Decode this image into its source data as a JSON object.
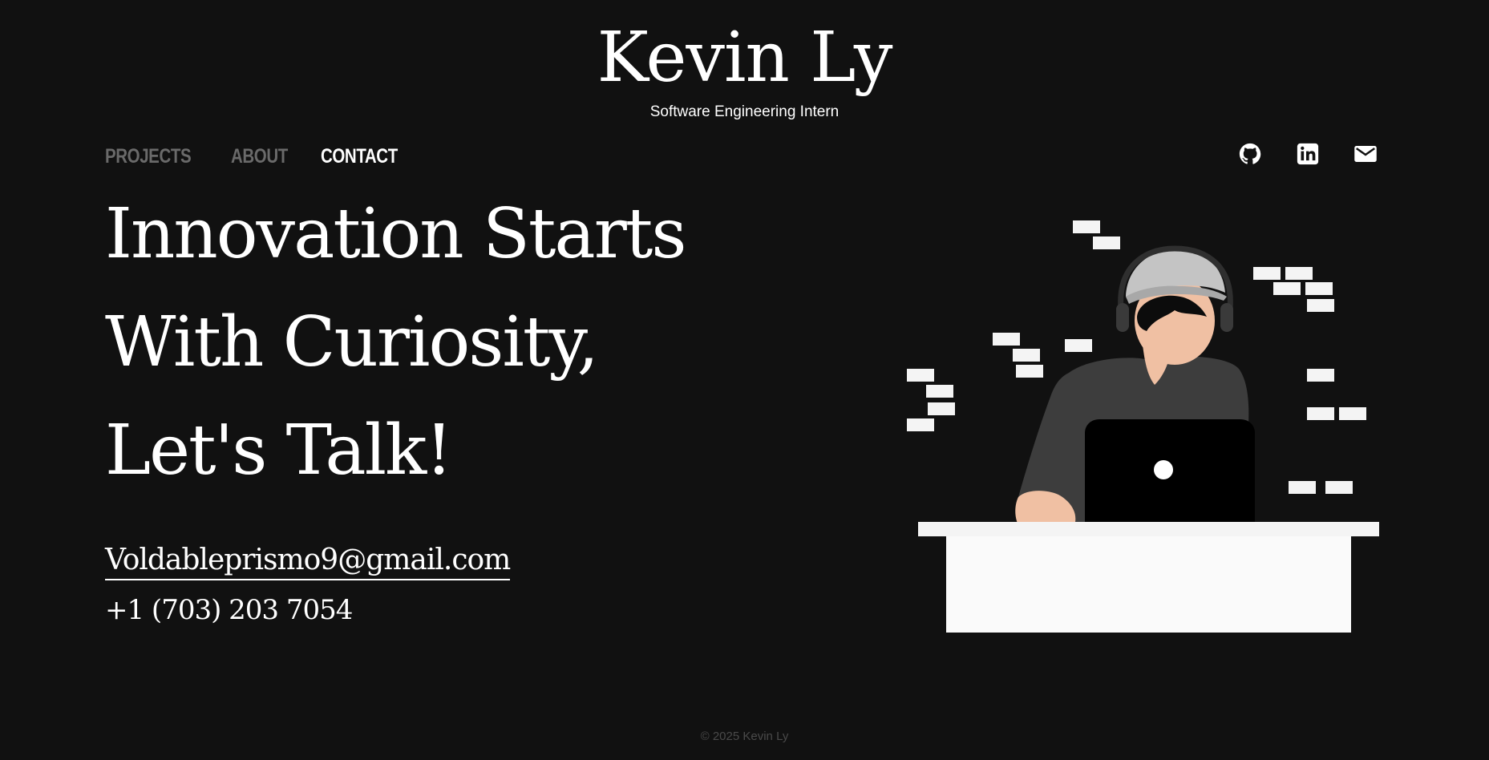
{
  "header": {
    "title": "Kevin Ly",
    "subtitle": "Software Engineering Intern"
  },
  "nav": {
    "items": [
      {
        "label": "PROJECTS",
        "active": false
      },
      {
        "label": "ABOUT",
        "active": false
      },
      {
        "label": "CONTACT",
        "active": true
      }
    ]
  },
  "social": {
    "icons": [
      "github-icon",
      "linkedin-icon",
      "mail-icon"
    ]
  },
  "hero": {
    "headline_lines": [
      "Innovation Starts",
      "With Curiosity,",
      "Let's Talk!"
    ],
    "email": "Voldableprismo9@gmail.com",
    "phone": "+1 (703) 203 7054"
  },
  "illustration": {
    "subject": "developer-at-laptop-illustration"
  },
  "footer": {
    "copyright": "© 2025 Kevin Ly"
  },
  "colors": {
    "background": "#111111",
    "text": "#ffffff",
    "nav_inactive": "#6a6a6a",
    "footer": "#4a4a4a"
  }
}
